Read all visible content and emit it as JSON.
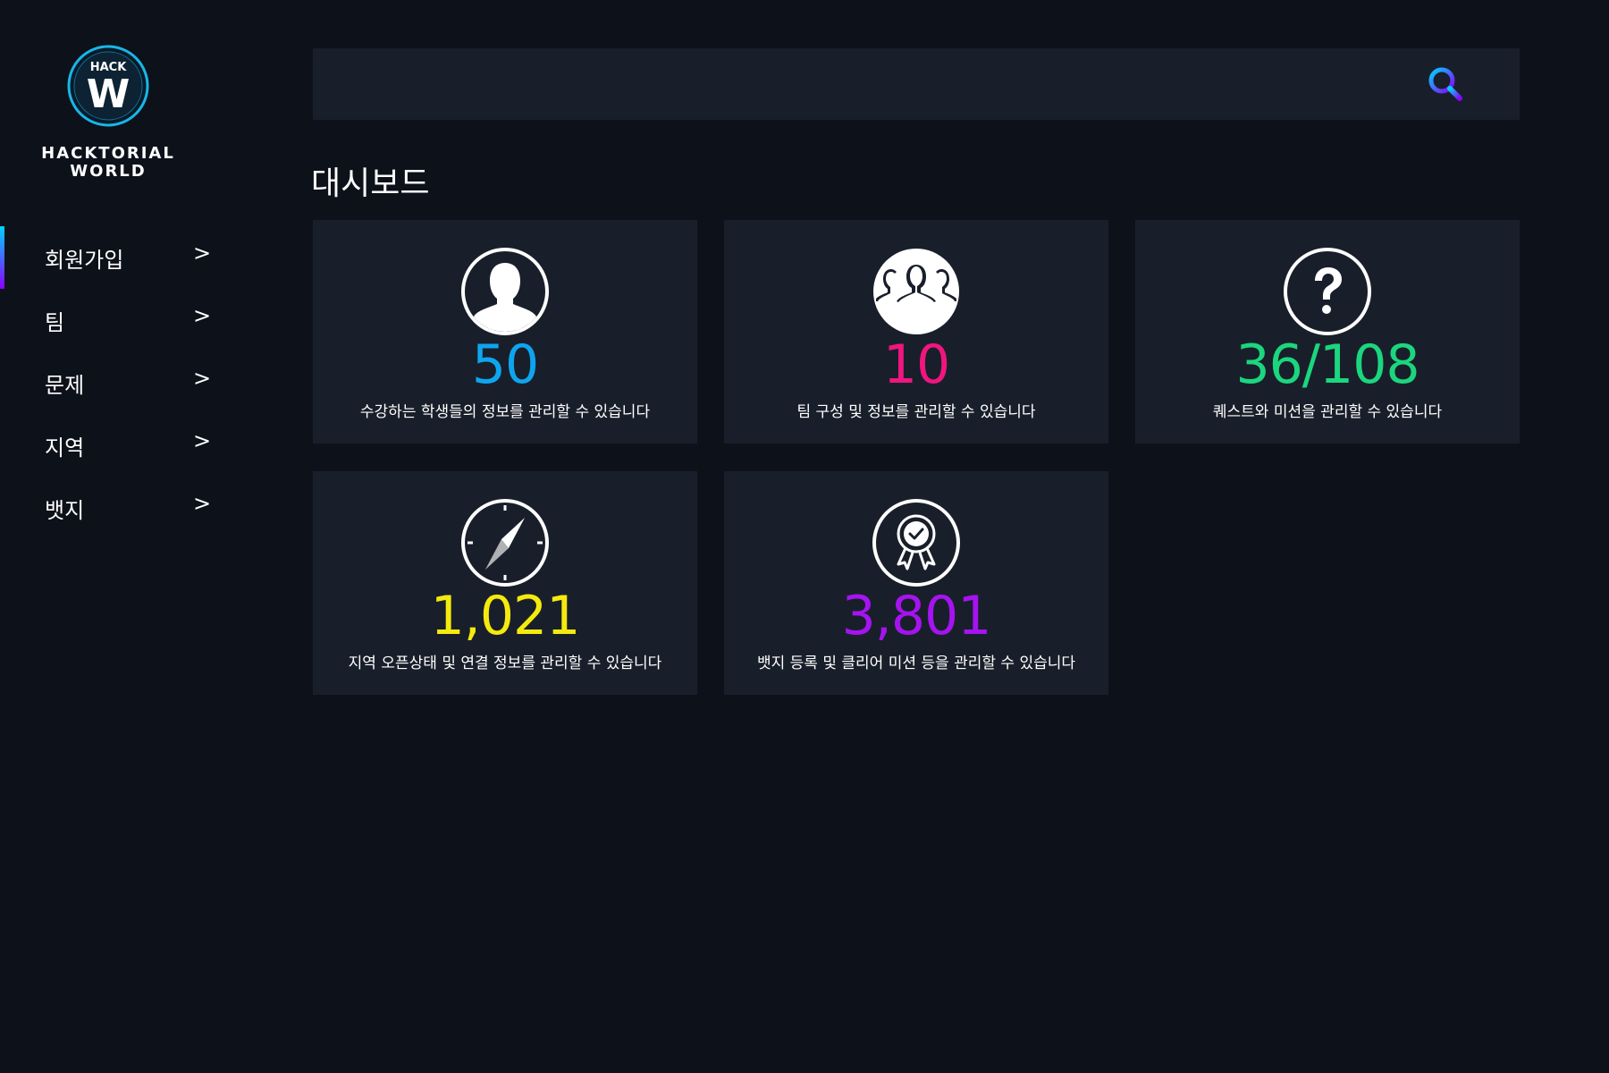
{
  "brand": {
    "badge_top": "HACK",
    "badge_letter": "W",
    "name": "HACKTORIAL\nWORLD"
  },
  "sidebar": {
    "items": [
      {
        "label": "회원가입",
        "arrow": ">",
        "active": true
      },
      {
        "label": "팀",
        "arrow": ">",
        "active": false
      },
      {
        "label": "문제",
        "arrow": ">",
        "active": false
      },
      {
        "label": "지역",
        "arrow": ">",
        "active": false
      },
      {
        "label": "뱃지",
        "arrow": ">",
        "active": false
      }
    ]
  },
  "search": {
    "placeholder": "",
    "value": "",
    "icon": "search-icon"
  },
  "main": {
    "title": "대시보드",
    "cards": [
      {
        "icon": "user-icon",
        "value": "50",
        "color": "#0ea5ef",
        "desc": "수강하는 학생들의 정보를 관리할 수 있습니다"
      },
      {
        "icon": "team-icon",
        "value": "10",
        "color": "#f0157f",
        "desc": "팀 구성 및 정보를 관리할 수 있습니다"
      },
      {
        "icon": "question-icon",
        "value": "36/108",
        "color": "#1bd67e",
        "desc": "퀘스트와 미션을 관리할 수 있습니다"
      },
      {
        "icon": "compass-icon",
        "value": "1,021",
        "color": "#f4ea0e",
        "desc": "지역 오픈상태 및 연결 정보를 관리할 수 있습니다"
      },
      {
        "icon": "badge-icon",
        "value": "3,801",
        "color": "#a513f0",
        "desc": "뱃지 등록 및 클리어 미션 등을 관리할 수 있습니다"
      }
    ]
  },
  "colors": {
    "background": "#0d111a",
    "panel": "#191f2a",
    "accent_gradient_start": "#00d2ff",
    "accent_gradient_end": "#8a00ff"
  }
}
